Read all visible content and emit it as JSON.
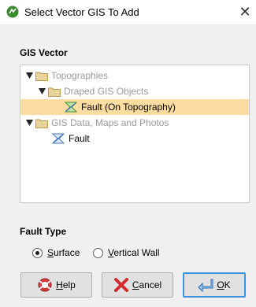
{
  "window": {
    "title": "Select Vector GIS To Add",
    "close_glyph": "✕"
  },
  "gis_vector": {
    "heading": "GIS Vector",
    "tree": [
      {
        "label": "Topographies",
        "icon": "folder-icon",
        "expanded": true,
        "style": "grey"
      },
      {
        "label": "Draped GIS Objects",
        "icon": "folder-icon",
        "expanded": true,
        "style": "grey"
      },
      {
        "label": "Fault (On Topography)",
        "icon": "gis-vector-icon",
        "selected": true,
        "style": "dark"
      },
      {
        "label": "GIS Data, Maps and Photos",
        "icon": "folder-icon",
        "expanded": true,
        "style": "grey"
      },
      {
        "label": "Fault",
        "icon": "gis-vector-icon",
        "selected": false,
        "style": "dark"
      }
    ]
  },
  "fault_type": {
    "heading": "Fault Type",
    "options": [
      {
        "mnemonic": "S",
        "rest": "urface",
        "checked": true
      },
      {
        "mnemonic": "V",
        "rest": "ertical Wall",
        "checked": false
      }
    ]
  },
  "buttons": {
    "help": {
      "mnemonic": "H",
      "rest": "elp"
    },
    "cancel": {
      "mnemonic": "C",
      "rest": "ancel"
    },
    "ok": {
      "mnemonic": "O",
      "rest": "K"
    }
  },
  "colors": {
    "selection": "#fcdca0",
    "ok_border": "#3c8fd8",
    "folder": "#e8d49a"
  }
}
